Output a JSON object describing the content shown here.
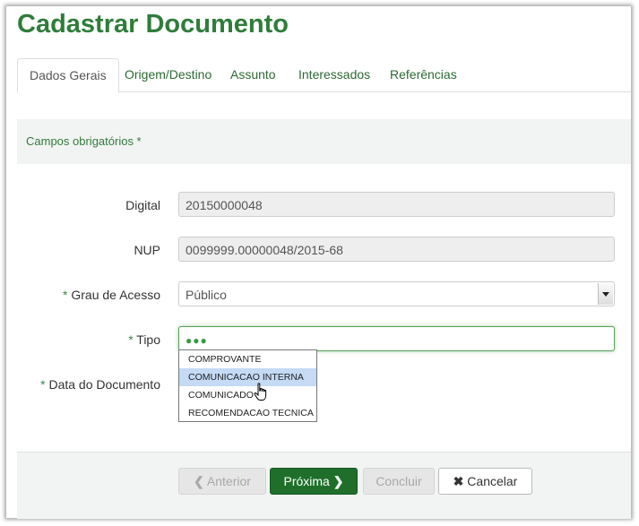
{
  "page": {
    "title": "Cadastrar Documento"
  },
  "tabs": [
    {
      "label": "Dados Gerais"
    },
    {
      "label": "Origem/Destino"
    },
    {
      "label": "Assunto"
    },
    {
      "label": "Interessados"
    },
    {
      "label": "Referências"
    }
  ],
  "notice": {
    "text": "Campos obrigatórios *"
  },
  "form": {
    "required_mark": "*",
    "digital": {
      "label": "Digital",
      "value": "20150000048"
    },
    "nup": {
      "label": "NUP",
      "value": "0099999.00000048/2015-68"
    },
    "grau_acesso": {
      "label": "Grau de Acesso",
      "value": "Público"
    },
    "tipo": {
      "label": "Tipo",
      "value": "●●●"
    },
    "data_documento": {
      "label": "Data do Documento"
    }
  },
  "dropdown": {
    "options": [
      "COMPROVANTE",
      "COMUNICACAO INTERNA",
      "COMUNICADO",
      "RECOMENDACAO TECNICA"
    ],
    "hovered": "COMUNICACAO INTERNA"
  },
  "footer": {
    "anterior": "Anterior",
    "proxima": "Próxima",
    "concluir": "Concluir",
    "cancelar": "Cancelar"
  },
  "colors": {
    "accent": "#2f7d3a",
    "primary_button": "#1f6f2b"
  }
}
